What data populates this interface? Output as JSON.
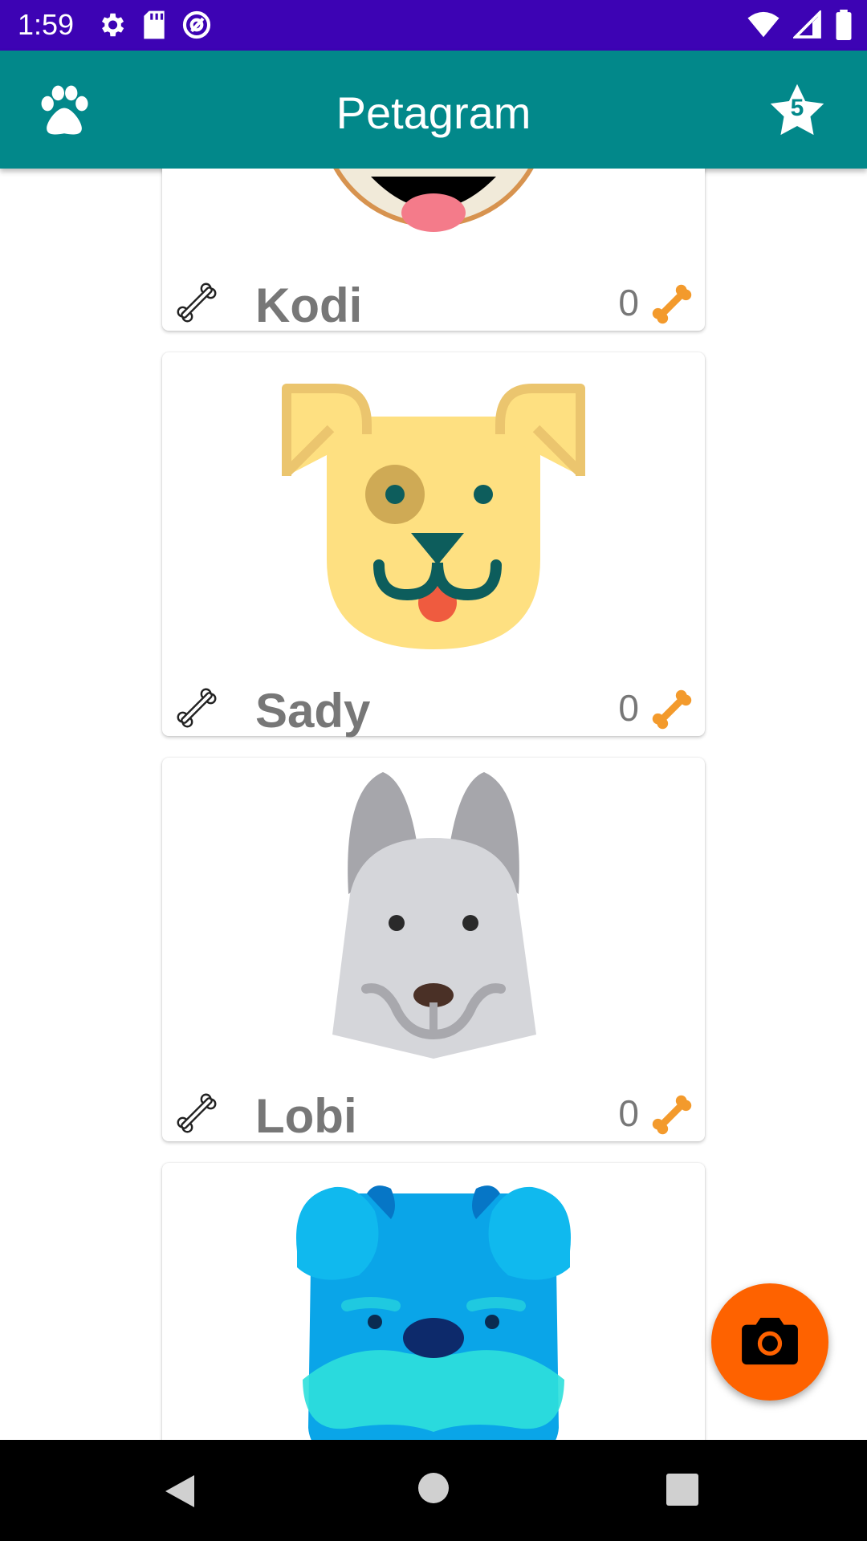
{
  "status_bar": {
    "time": "1:59",
    "left_icons": [
      "gear-icon",
      "sd-card-icon",
      "at-sign-icon"
    ],
    "right_icons": [
      "wifi-icon",
      "cellular-signal-icon",
      "battery-icon"
    ],
    "background_color": "#3d03b4"
  },
  "app_bar": {
    "title": "Petagram",
    "leading_icon": "paw-icon",
    "favorites_icon": "star-icon",
    "favorites_count": "5",
    "background_color": "#02888a"
  },
  "pets": [
    {
      "name": "Kodi",
      "likes": "0",
      "image_icon": "bulldog-face-icon"
    },
    {
      "name": "Sady",
      "likes": "0",
      "image_icon": "yellow-dog-face-icon"
    },
    {
      "name": "Lobi",
      "likes": "0",
      "image_icon": "gray-husky-face-icon"
    },
    {
      "name": "",
      "likes": "",
      "image_icon": "blue-bulldog-face-icon"
    }
  ],
  "card_icons": {
    "like_button_icon": "bone-outline-icon",
    "likes_icon": "bone-orange-icon"
  },
  "fab": {
    "icon": "camera-icon",
    "background_color": "#fe6200"
  },
  "nav_bar": {
    "icons": [
      "back-icon",
      "home-icon",
      "recents-icon"
    ]
  }
}
